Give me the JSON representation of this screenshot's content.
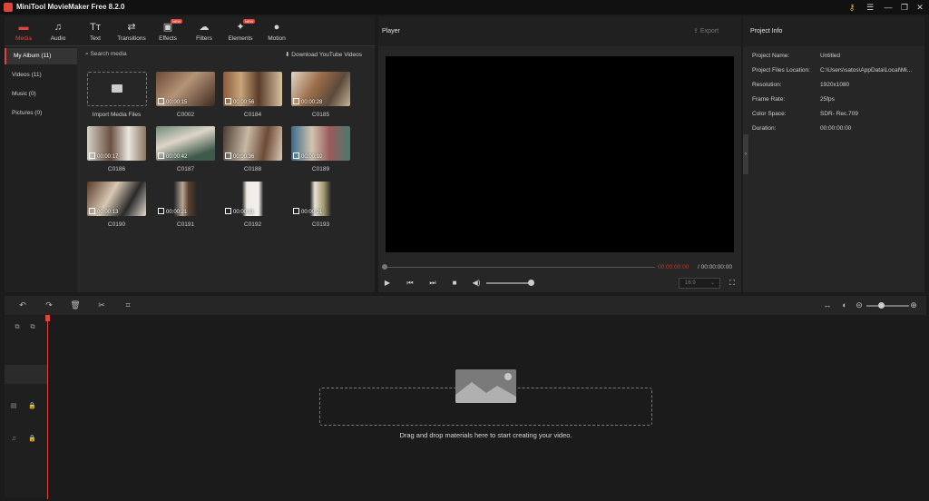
{
  "app": {
    "title": "MiniTool MovieMaker Free 8.2.0"
  },
  "toolbar": {
    "tabs": [
      {
        "label": "Media",
        "icon": "folder-icon",
        "active": true
      },
      {
        "label": "Audio",
        "icon": "music-note-icon"
      },
      {
        "label": "Text",
        "icon": "text-icon"
      },
      {
        "label": "Transitions",
        "icon": "transitions-icon"
      },
      {
        "label": "Effects",
        "icon": "effects-icon",
        "badge": "NEW"
      },
      {
        "label": "Filters",
        "icon": "filters-icon"
      },
      {
        "label": "Elements",
        "icon": "elements-icon",
        "badge": "NEW"
      },
      {
        "label": "Motion",
        "icon": "motion-icon"
      }
    ]
  },
  "sidebar": {
    "items": [
      {
        "label": "My Album (11)",
        "active": true
      },
      {
        "label": "Videos (11)"
      },
      {
        "label": "Music (0)"
      },
      {
        "label": "Pictures (0)"
      }
    ]
  },
  "media": {
    "search_label": "Search media",
    "download_label": "Download YouTube Videos",
    "import_label": "Import Media Files",
    "clips": [
      {
        "name": "C0002",
        "duration": "00:00:15"
      },
      {
        "name": "C0184",
        "duration": "00:00:56"
      },
      {
        "name": "C0185",
        "duration": "00:00:28"
      },
      {
        "name": "C0186",
        "duration": "00:00:17"
      },
      {
        "name": "C0187",
        "duration": "00:00:42"
      },
      {
        "name": "C0188",
        "duration": "00:00:36"
      },
      {
        "name": "C0189",
        "duration": "00:00:10"
      },
      {
        "name": "C0190",
        "duration": "00:00:13"
      },
      {
        "name": "C0191",
        "duration": "00:00:21"
      },
      {
        "name": "C0192",
        "duration": "00:00:11"
      },
      {
        "name": "C0193",
        "duration": "00:00:21"
      }
    ]
  },
  "player": {
    "title": "Player",
    "export_label": "Export",
    "time_current": "00:00:00:00",
    "time_total": "/ 00:00:00:00",
    "aspect": "16:9"
  },
  "project_info": {
    "title": "Project Info",
    "rows": [
      {
        "label": "Project Name:",
        "value": "Untitled"
      },
      {
        "label": "Project Files Location:",
        "value": "C:\\Users\\satos\\AppData\\Local\\Mi..."
      },
      {
        "label": "Resolution:",
        "value": "1920x1080"
      },
      {
        "label": "Frame Rate:",
        "value": "25fps"
      },
      {
        "label": "Color Space:",
        "value": "SDR- Rec.709"
      },
      {
        "label": "Duration:",
        "value": "00:00:00:00"
      }
    ]
  },
  "timeline": {
    "drop_text": "Drag and drop materials here to start creating your video."
  },
  "colors": {
    "accent": "#e0443a",
    "panel": "#262626",
    "background": "#1b1b1b"
  }
}
